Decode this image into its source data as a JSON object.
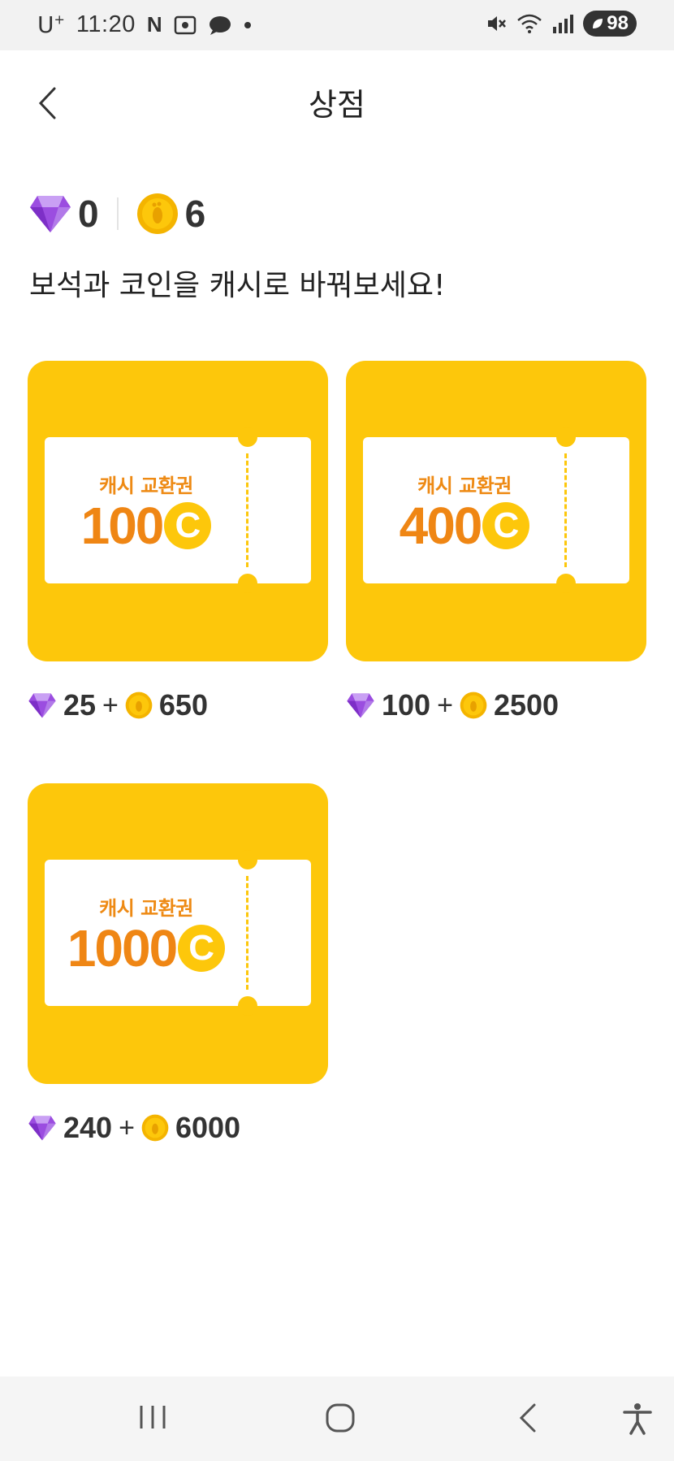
{
  "status_bar": {
    "carrier": "U",
    "carrier_sup": "+",
    "time": "11:20",
    "notif_letter": "N",
    "battery": "98"
  },
  "header": {
    "title": "상점"
  },
  "balance": {
    "gems": "0",
    "coins": "6"
  },
  "subtitle": "보석과 코인을 캐시로 바꿔보세요!",
  "products": [
    {
      "label": "캐시 교환권",
      "amount": "100",
      "badge": "C",
      "gem_price": "25",
      "plus": "+",
      "coin_price": "650"
    },
    {
      "label": "캐시 교환권",
      "amount": "400",
      "badge": "C",
      "gem_price": "100",
      "plus": "+",
      "coin_price": "2500"
    },
    {
      "label": "캐시 교환권",
      "amount": "1000",
      "badge": "C",
      "gem_price": "240",
      "plus": "+",
      "coin_price": "6000"
    }
  ],
  "colors": {
    "card_bg": "#fdc70b",
    "ticket_text": "#ef8614",
    "gem": "#9b4de0"
  },
  "icons": {
    "gem": "gem-icon",
    "coin": "coin-icon",
    "back": "back-arrow-icon"
  }
}
